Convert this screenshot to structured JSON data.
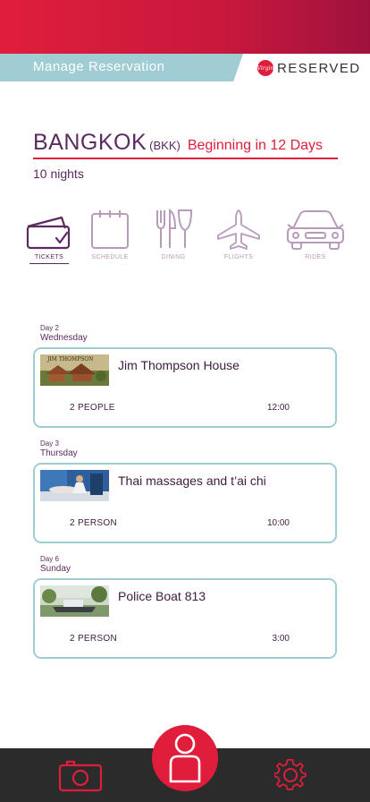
{
  "header": {
    "manage_title": "Manage Reservation",
    "brand": "RESERVED",
    "brand_logo": "Virgin"
  },
  "trip": {
    "city": "BANGKOK",
    "code": "(BKK)",
    "beginning": "Beginning in 12 Days",
    "nights": "10 nights"
  },
  "tabs": [
    {
      "label": "TICKETS",
      "icon": "ticket-icon",
      "active": true
    },
    {
      "label": "SCHEDULE",
      "icon": "calendar-icon",
      "active": false
    },
    {
      "label": "DINING",
      "icon": "dining-icon",
      "active": false
    },
    {
      "label": "FLIGHTS",
      "icon": "airplane-icon",
      "active": false
    },
    {
      "label": "RIDES",
      "icon": "car-icon",
      "active": false
    }
  ],
  "days": [
    {
      "day": "Day 2",
      "weekday": "Wednesday",
      "card": {
        "title": "Jim Thompson House",
        "people": "2 PEOPLE",
        "time": "12:00",
        "thumb_text": "JIM THOMPSON"
      }
    },
    {
      "day": "Day 3",
      "weekday": "Thursday",
      "card": {
        "title": "Thai massages and t’ai chi",
        "people": "2 PERSON",
        "time": "10:00"
      }
    },
    {
      "day": "Day 6",
      "weekday": "Sunday",
      "card": {
        "title": "Police Boat 813",
        "people": "2 PERSON",
        "time": "3:00"
      }
    }
  ],
  "bottom_nav": {
    "left_icon": "camera-icon",
    "center_icon": "profile-icon",
    "right_icon": "gear-icon"
  },
  "colors": {
    "accent": "#e01e3c",
    "teal": "#9fcdd3",
    "purple": "#5b2a5e"
  }
}
